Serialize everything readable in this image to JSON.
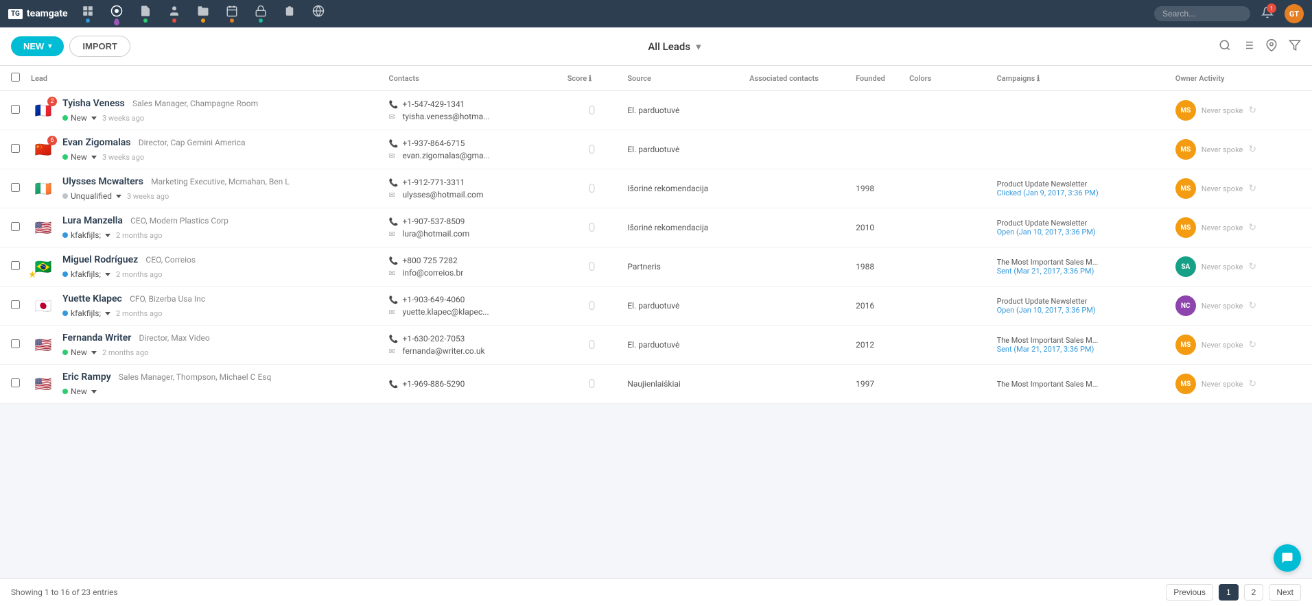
{
  "app": {
    "name": "teamgate",
    "logo_text": "TG"
  },
  "nav": {
    "icons": [
      {
        "id": "grid",
        "label": "Dashboard",
        "dot_color": "#3498db",
        "active": false
      },
      {
        "id": "target",
        "label": "Leads",
        "dot_color": "#9b59b6",
        "active": true
      },
      {
        "id": "document",
        "label": "Contacts",
        "dot_color": "#2ecc71",
        "active": false
      },
      {
        "id": "person",
        "label": "People",
        "dot_color": "#e74c3c",
        "active": false
      },
      {
        "id": "folder",
        "label": "Companies",
        "dot_color": "#f39c12",
        "active": false
      },
      {
        "id": "calendar",
        "label": "Activities",
        "dot_color": "#e67e22",
        "active": false
      },
      {
        "id": "lock",
        "label": "Security",
        "dot_color": "#1abc9c",
        "active": false
      },
      {
        "id": "receipt",
        "label": "Deals",
        "dot_color": "",
        "active": false
      },
      {
        "id": "globe",
        "label": "Reports",
        "dot_color": "",
        "active": false
      }
    ],
    "search_placeholder": "Search...",
    "user_initials": "GT",
    "notifications_count": "1"
  },
  "toolbar": {
    "new_label": "NEW",
    "import_label": "IMPORT",
    "title": "All Leads",
    "dropdown_arrow": "▾"
  },
  "table": {
    "columns": [
      "Lead",
      "Contacts",
      "Score",
      "Source",
      "Associated contacts",
      "Founded",
      "Colors",
      "Campaigns",
      "Owner Activity"
    ],
    "rows": [
      {
        "id": 1,
        "flag": "🇫🇷",
        "count_badge": "2",
        "name": "Tyisha Veness",
        "title": "Sales Manager, Champagne Room",
        "status": "New",
        "status_type": "new",
        "time_ago": "3 weeks ago",
        "phone": "+1-547-429-1341",
        "email": "tyisha.veness@hotma...",
        "score": "0",
        "source": "El. parduotuvė",
        "assoc_contacts": "",
        "founded": "",
        "colors": "",
        "campaign_title": "",
        "campaign_action": "",
        "owner_initials": "MS",
        "owner_color": "#f39c12",
        "owner_activity": "Never spoke",
        "starred": false
      },
      {
        "id": 2,
        "flag": "🇨🇳",
        "count_badge": "6",
        "name": "Evan Zigomalas",
        "title": "Director, Cap Gemini America",
        "status": "New",
        "status_type": "new",
        "time_ago": "3 weeks ago",
        "phone": "+1-937-864-6715",
        "email": "evan.zigomalas@gma...",
        "score": "0",
        "source": "El. parduotuvė",
        "assoc_contacts": "",
        "founded": "",
        "colors": "",
        "campaign_title": "",
        "campaign_action": "",
        "owner_initials": "MS",
        "owner_color": "#f39c12",
        "owner_activity": "Never spoke",
        "starred": false
      },
      {
        "id": 3,
        "flag": "🇮🇪",
        "count_badge": "",
        "name": "Ulysses Mcwalters",
        "title": "Marketing Executive, Mcmahan, Ben L",
        "status": "Unqualified",
        "status_type": "unqualified",
        "time_ago": "3 weeks ago",
        "phone": "+1-912-771-3311",
        "email": "ulysses@hotmail.com",
        "score": "0",
        "source": "Išorinė rekomendacija",
        "assoc_contacts": "",
        "founded": "1998",
        "colors": "",
        "campaign_title": "Product Update Newsletter",
        "campaign_action": "Clicked (Jan 9, 2017, 3:36 PM)",
        "owner_initials": "MS",
        "owner_color": "#f39c12",
        "owner_activity": "Never spoke",
        "starred": false
      },
      {
        "id": 4,
        "flag": "🇺🇸",
        "count_badge": "",
        "name": "Lura Manzella",
        "title": "CEO, Modern Plastics Corp",
        "status": "kfakfijls;",
        "status_type": "kfak",
        "time_ago": "2 months ago",
        "phone": "+1-907-537-8509",
        "email": "lura@hotmail.com",
        "score": "0",
        "source": "Išorinė rekomendacija",
        "assoc_contacts": "",
        "founded": "2010",
        "colors": "",
        "campaign_title": "Product Update Newsletter",
        "campaign_action": "Open (Jan 10, 2017, 3:36 PM)",
        "owner_initials": "MS",
        "owner_color": "#f39c12",
        "owner_activity": "Never spoke",
        "starred": false
      },
      {
        "id": 5,
        "flag": "🇧🇷",
        "count_badge": "",
        "name": "Miguel Rodríguez",
        "title": "CEO, Correios",
        "status": "kfakfijls;",
        "status_type": "kfak",
        "time_ago": "2 months ago",
        "phone": "+800 725 7282",
        "email": "info@correios.br",
        "score": "0",
        "source": "Partneris",
        "assoc_contacts": "",
        "founded": "1988",
        "colors": "",
        "campaign_title": "The Most Important Sales M...",
        "campaign_action": "Sent (Mar 21, 2017, 3:36 PM)",
        "owner_initials": "SA",
        "owner_color": "#16a085",
        "owner_activity": "Never spoke",
        "starred": true
      },
      {
        "id": 6,
        "flag": "🇯🇵",
        "count_badge": "",
        "name": "Yuette Klapec",
        "title": "CFO, Bizerba Usa Inc",
        "status": "kfakfijls;",
        "status_type": "kfak",
        "time_ago": "2 months ago",
        "phone": "+1-903-649-4060",
        "email": "yuette.klapec@klapec...",
        "score": "0",
        "source": "El. parduotuvė",
        "assoc_contacts": "",
        "founded": "2016",
        "colors": "",
        "campaign_title": "Product Update Newsletter",
        "campaign_action": "Open (Jan 10, 2017, 3:36 PM)",
        "owner_initials": "NC",
        "owner_color": "#8e44ad",
        "owner_activity": "Never spoke",
        "starred": false
      },
      {
        "id": 7,
        "flag": "🇺🇸",
        "count_badge": "",
        "name": "Fernanda Writer",
        "title": "Director, Max Video",
        "status": "New",
        "status_type": "new",
        "time_ago": "2 months ago",
        "phone": "+1-630-202-7053",
        "email": "fernanda@writer.co.uk",
        "score": "0",
        "source": "El. parduotuvė",
        "assoc_contacts": "",
        "founded": "2012",
        "colors": "",
        "campaign_title": "The Most Important Sales M...",
        "campaign_action": "Sent (Mar 21, 2017, 3:36 PM)",
        "owner_initials": "MS",
        "owner_color": "#f39c12",
        "owner_activity": "Never spoke",
        "starred": false
      },
      {
        "id": 8,
        "flag": "🇺🇸",
        "count_badge": "",
        "name": "Eric Rampy",
        "title": "Sales Manager, Thompson, Michael C Esq",
        "status": "New",
        "status_type": "new",
        "time_ago": "",
        "phone": "+1-969-886-5290",
        "email": "",
        "score": "0",
        "source": "Naujienlaiškiai",
        "assoc_contacts": "",
        "founded": "1997",
        "colors": "",
        "campaign_title": "The Most Important Sales M...",
        "campaign_action": "",
        "owner_initials": "MS",
        "owner_color": "#f39c12",
        "owner_activity": "Never spoke",
        "starred": false
      }
    ]
  },
  "footer": {
    "showing_text": "Showing 1 to 16 of 23 entries",
    "prev_label": "Previous",
    "page_1": "1",
    "page_2": "2",
    "next_label": "Next"
  }
}
